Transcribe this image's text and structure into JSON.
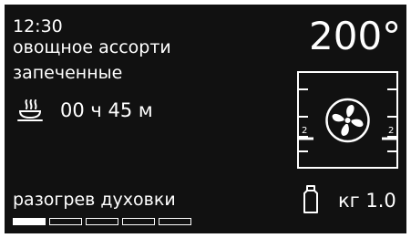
{
  "clock": {
    "time": "12:30"
  },
  "program": {
    "name": "овощное ассорти",
    "mode": "запеченные"
  },
  "timer": {
    "icon": "steaming-dish-icon",
    "value": "00 ч 45 м"
  },
  "oven": {
    "temperature": "200°",
    "cavity_icon": "oven-cavity-icon",
    "fan_icon": "convection-fan-icon",
    "shelf_level_left": "2",
    "shelf_level_right": "2"
  },
  "status": {
    "text": "разогрев духовки"
  },
  "weight": {
    "icon": "weight-icon",
    "value": "кг 1.0"
  },
  "progress": {
    "total_segments": 5,
    "active_segments": 1
  },
  "colors": {
    "background": "#111111",
    "foreground": "#ffffff"
  }
}
